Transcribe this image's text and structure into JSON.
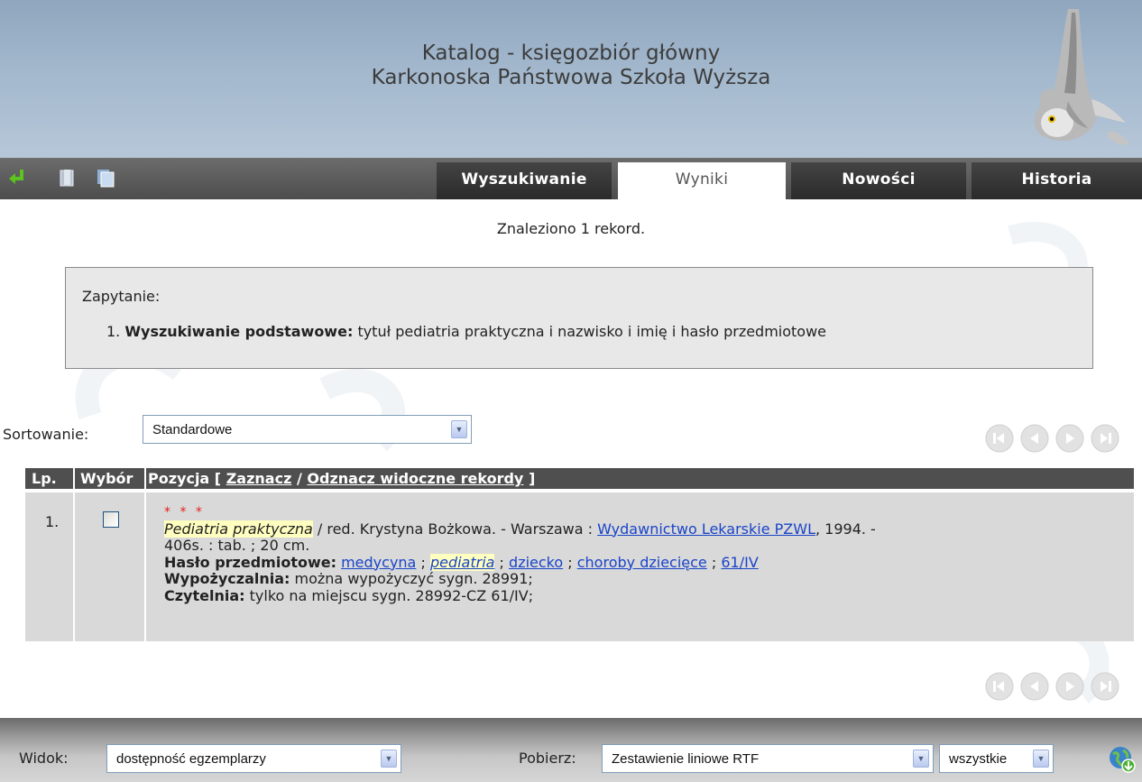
{
  "header": {
    "title_line1": "Katalog - księgozbiór główny",
    "title_line2": "Karkonoska Państwowa Szkoła Wyższa"
  },
  "toolbar": {
    "icons": [
      "return-arrow-icon",
      "copy-page-icon",
      "copy-pages-icon"
    ]
  },
  "tabs": [
    {
      "label": "Wyszukiwanie",
      "active": false
    },
    {
      "label": "Wyniki",
      "active": true
    },
    {
      "label": "Nowości",
      "active": false
    },
    {
      "label": "Historia",
      "active": false
    }
  ],
  "results": {
    "found_text": "Znaleziono 1 rekord."
  },
  "query": {
    "label": "Zapytanie:",
    "number": "1.",
    "type": "Wyszukiwanie podstawowe:",
    "text": "tytuł pediatria praktyczna i nazwisko i imię i hasło przedmiotowe"
  },
  "sort": {
    "label": "Sortowanie:",
    "selected": "Standardowe"
  },
  "table": {
    "col_lp": "Lp.",
    "col_wybor": "Wybór",
    "col_pozycja": "Pozycja [",
    "mark_link": "Zaznacz",
    "sep": "/",
    "unmark_link": "Odznacz widoczne rekordy",
    "close": "]"
  },
  "record": {
    "number": "1.",
    "checked": false,
    "stars": "* * *",
    "title": "Pediatria praktyczna",
    "desc_a": " / red. Krystyna Bożkowa. - Warszawa : ",
    "publisher": "Wydawnictwo Lekarskie PZWL",
    "desc_b": ", 1994. -",
    "desc_c": "406s. : tab. ; 20 cm.",
    "subjects_label": "Hasło przedmiotowe:",
    "subjects": [
      "medycyna",
      "pediatria",
      "dziecko",
      "choroby dziecięce",
      "61/IV"
    ],
    "subject_sep": ";",
    "lending_label": "Wypożyczalnia:",
    "lending_text": "można wypożyczyć sygn. 28991;",
    "reading_label": "Czytelnia:",
    "reading_text": "tylko na miejscu sygn. 28992-CZ 61/IV;"
  },
  "footer": {
    "view_label": "Widok:",
    "view_selected": "dostępność egzemplarzy",
    "download_label": "Pobierz:",
    "download_selected": "Zestawienie liniowe RTF",
    "scope_selected": "wszystkie"
  },
  "colors": {
    "header_bg": "#a3b8cd",
    "tab_bg": "#333333",
    "link": "#1a44c8",
    "highlight": "#ffffc0",
    "stars": "#e32020"
  }
}
